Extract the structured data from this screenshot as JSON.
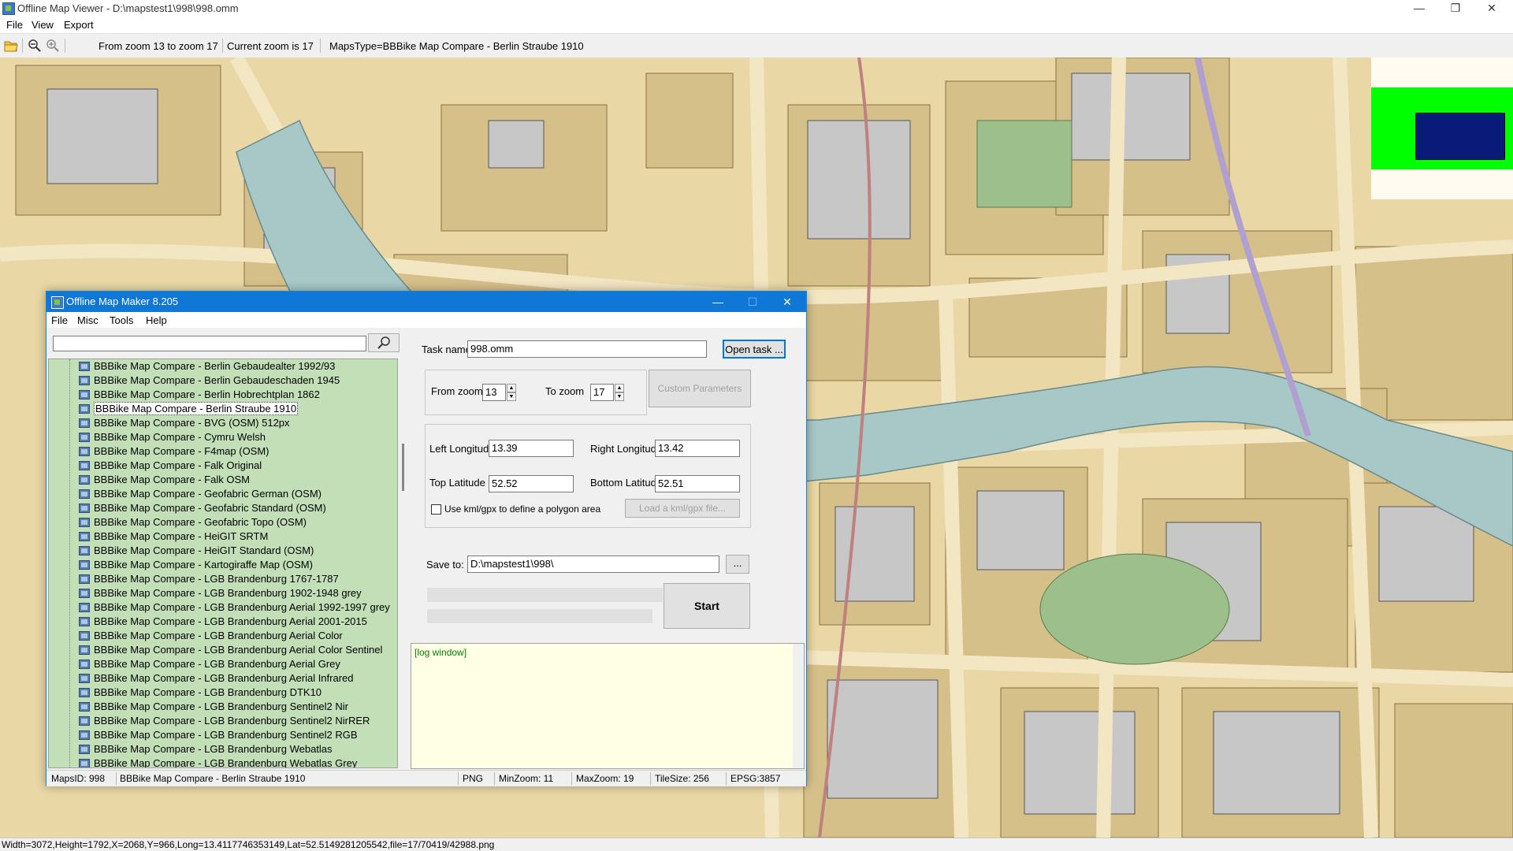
{
  "window": {
    "title": "Offline Map Viewer - D:\\mapstest1\\998\\998.omm",
    "controls": {
      "minimize": "—",
      "maximize": "❐",
      "close": "✕"
    }
  },
  "menubar": {
    "items": [
      "File",
      "View",
      "Export"
    ]
  },
  "toolbar": {
    "icons": [
      "open-folder-icon",
      "zoom-out-icon",
      "zoom-in-icon"
    ],
    "zoom_range": "From zoom 13 to zoom 17",
    "current_zoom": "Current zoom is 17",
    "maps_type": "MapsType=BBBike Map Compare - Berlin Straube 1910"
  },
  "map": {
    "overview_colors": {
      "background": "#fffbf0",
      "viewport": "#00ff00",
      "current": "#0a1a78"
    },
    "palette": {
      "land": "#e9d8a6",
      "street": "#f3e6c3",
      "block": "#d6c08a",
      "building": "#c7c7c7",
      "water": "#a8c8c8",
      "park": "#9cbf8c"
    }
  },
  "status_bar": "Width=3072,Height=1792,X=2068,Y=966,Long=13.4117746353149,Lat=52.5149281205542,file=17/70419/42988.png",
  "dialog": {
    "title": "Offline Map Maker 8.205",
    "controls": {
      "minimize": "—",
      "maximize": "☐",
      "close": "✕"
    },
    "menu": [
      "File",
      "Misc",
      "Tools",
      "Help"
    ],
    "search": {
      "value": "",
      "button_icon": "search-icon"
    },
    "map_list": {
      "selected_index": 3,
      "items": [
        "BBBike Map Compare - Berlin Gebaudealter 1992/93",
        "BBBike Map Compare - Berlin Gebaudeschaden 1945",
        "BBBike Map Compare - Berlin Hobrechtplan 1862",
        "BBBike Map Compare - Berlin Straube 1910",
        "BBBike Map Compare - BVG (OSM) 512px",
        "BBBike Map Compare - Cymru Welsh",
        "BBBike Map Compare - F4map (OSM)",
        "BBBike Map Compare - Falk Original",
        "BBBike Map Compare - Falk OSM",
        "BBBike Map Compare - Geofabric German (OSM)",
        "BBBike Map Compare - Geofabric Standard (OSM)",
        "BBBike Map Compare - Geofabric Topo (OSM)",
        "BBBike Map Compare - HeiGIT SRTM",
        "BBBike Map Compare - HeiGIT Standard (OSM)",
        "BBBike Map Compare - Kartogiraffe Map (OSM)",
        "BBBike Map Compare - LGB Brandenburg 1767-1787",
        "BBBike Map Compare - LGB Brandenburg 1902-1948 grey",
        "BBBike Map Compare - LGB Brandenburg Aerial 1992-1997 grey",
        "BBBike Map Compare - LGB Brandenburg Aerial 2001-2015",
        "BBBike Map Compare - LGB Brandenburg Aerial Color",
        "BBBike Map Compare - LGB Brandenburg Aerial Color Sentinel",
        "BBBike Map Compare - LGB Brandenburg Aerial Grey",
        "BBBike Map Compare - LGB Brandenburg Aerial Infrared",
        "BBBike Map Compare - LGB Brandenburg DTK10",
        "BBBike Map Compare - LGB Brandenburg Sentinel2 Nir",
        "BBBike Map Compare - LGB Brandenburg Sentinel2 NirRER",
        "BBBike Map Compare - LGB Brandenburg Sentinel2 RGB",
        "BBBike Map Compare - LGB Brandenburg Webatlas",
        "BBBike Map Compare - LGB Brandenburg Webatlas Grey"
      ]
    },
    "task": {
      "task_name_label": "Task name",
      "task_name_value": "998.omm",
      "open_task_label": "Open task ...",
      "from_zoom_label": "From zoom",
      "from_zoom_value": "13",
      "to_zoom_label": "To zoom",
      "to_zoom_value": "17",
      "custom_params_label": "Custom Parameters",
      "left_lon_label": "Left Longitude",
      "left_lon_value": "13.39",
      "right_lon_label": "Right Longitude",
      "right_lon_value": "13.42",
      "top_lat_label": "Top Latitude",
      "top_lat_value": "52.52",
      "bottom_lat_label": "Bottom Latitude",
      "bottom_lat_value": "52.51",
      "polygon_checkbox_label": "Use kml/gpx to define a polygon area",
      "polygon_checked": false,
      "load_kml_label": "Load a kml/gpx file...",
      "save_to_label": "Save to:",
      "save_to_value": "D:\\mapstest1\\998\\",
      "browse_label": "...",
      "start_label": "Start"
    },
    "log_text": "[log window]",
    "status": {
      "maps_id": "MapsID: 998",
      "map_name": "BBBike Map Compare - Berlin Straube 1910",
      "format": "PNG",
      "min_zoom": "MinZoom: 11",
      "max_zoom": "MaxZoom: 19",
      "tile_size": "TileSize: 256",
      "epsg": "EPSG:3857"
    }
  }
}
